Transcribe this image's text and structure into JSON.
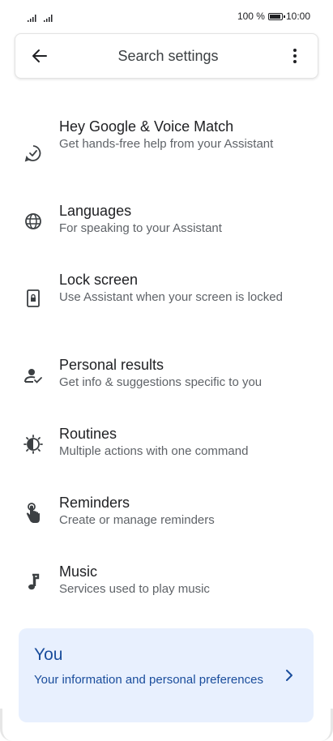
{
  "status_bar": {
    "battery_text": "100 %",
    "time": "10:00",
    "battery_level": 1.0
  },
  "search": {
    "placeholder": "Search settings",
    "back_icon": "arrow-back-icon",
    "menu_icon": "more-vert-icon"
  },
  "settings": {
    "items": [
      {
        "title": "Hey Google & Voice Match",
        "subtitle": "Get hands-free help from your Assistant",
        "icon": "voice-match-icon"
      },
      {
        "title": "Languages",
        "subtitle": "For speaking to your Assistant",
        "icon": "globe-icon"
      },
      {
        "title": "Lock screen",
        "subtitle": "Use Assistant when your screen is locked",
        "icon": "lock-screen-icon"
      },
      {
        "title": "Personal results",
        "subtitle": "Get info & suggestions specific to you",
        "icon": "person-check-icon"
      },
      {
        "title": "Routines",
        "subtitle": "Multiple actions with one command",
        "icon": "routines-icon"
      },
      {
        "title": "Reminders",
        "subtitle": "Create or manage reminders",
        "icon": "reminder-hand-icon"
      },
      {
        "title": "Music",
        "subtitle": "Services used to play music",
        "icon": "music-note-icon"
      }
    ]
  },
  "you_card": {
    "title": "You",
    "subtitle": "Your information and personal preferences",
    "icon": "chevron-right-icon"
  },
  "colors": {
    "accent": "#1a4d9c",
    "card_bg": "#e8f0fe",
    "text_primary": "#202124",
    "text_secondary": "#5f6368"
  }
}
